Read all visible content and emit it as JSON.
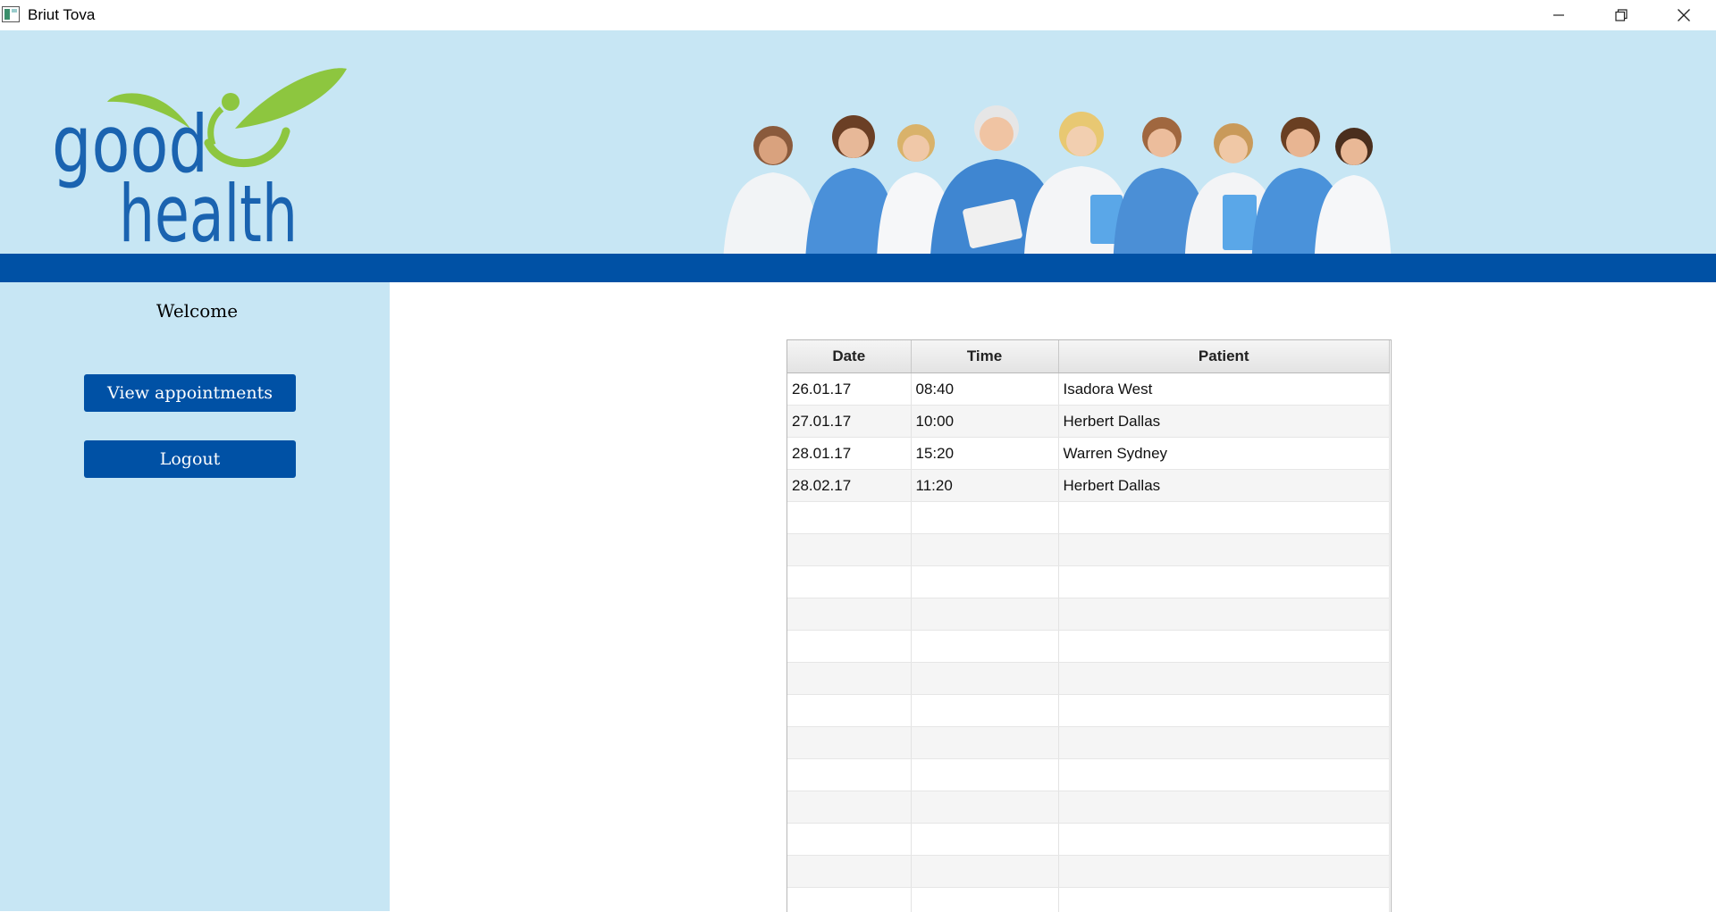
{
  "window": {
    "title": "Briut Tova",
    "icons": [
      "app-icon",
      "minimize-icon",
      "restore-icon",
      "close-icon"
    ]
  },
  "header": {
    "logo_text_line1": "good",
    "logo_text_line2": "health",
    "colors": {
      "banner": "#c7e6f4",
      "bar": "#0051a5",
      "logo_blue": "#1a63b0",
      "logo_green": "#8dc63f"
    }
  },
  "sidebar": {
    "welcome": "Welcome",
    "buttons": [
      {
        "label": "View appointments"
      },
      {
        "label": "Logout"
      }
    ]
  },
  "appointments": {
    "columns": [
      "Date",
      "Time",
      "Patient"
    ],
    "rows": [
      {
        "date": "26.01.17",
        "time": "08:40",
        "patient": "Isadora West"
      },
      {
        "date": "27.01.17",
        "time": "10:00",
        "patient": "Herbert Dallas"
      },
      {
        "date": "28.01.17",
        "time": "15:20",
        "patient": "Warren Sydney"
      },
      {
        "date": "28.02.17",
        "time": "11:20",
        "patient": "Herbert Dallas"
      }
    ]
  }
}
